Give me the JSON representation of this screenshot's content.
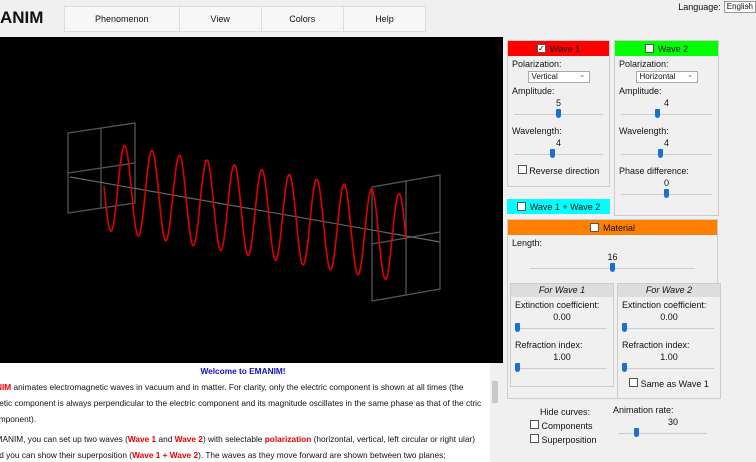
{
  "app": {
    "title": "ANIM"
  },
  "menu": [
    "Phenomenon",
    "View",
    "Colors",
    "Help"
  ],
  "language": {
    "label": "Language:",
    "value": "English"
  },
  "text": {
    "title": "Welcome to EMANIM!",
    "p1_strong": "ANIM",
    "p1": " animates electromagnetic waves in vacuum and in matter. For clarity, only the electric component is shown at all times (the gnetic component is always perpendicular to the electric component and its magnitude oscillates in the same phase as that of the ctric component).",
    "p2_a": "EMANIM, you can set up two waves (",
    "p2_w1": "Wave 1",
    "p2_and": " and ",
    "p2_w2": "Wave 2",
    "p2_b": ") with selectable ",
    "p2_pol": "polarization",
    "p2_c": " (horizontal, vertical, left circular or right ular) and you can show their superposition (",
    "p2_sum": "Wave 1 + Wave 2",
    "p2_d": "). The waves as they move forward are shown between two planes;"
  },
  "wave1": {
    "label": "Wave 1",
    "checked": true,
    "color": "#ff0000",
    "polarization_label": "Polarization:",
    "polarization": "Vertical",
    "amplitude_label": "Amplitude:",
    "amplitude": "5",
    "amplitude_frac": 0.5,
    "wavelength_label": "Wavelength:",
    "wavelength": "4",
    "wavelength_frac": 0.43,
    "reverse_label": "Reverse direction"
  },
  "wave2": {
    "label": "Wave 2",
    "checked": false,
    "color": "#00ff00",
    "polarization_label": "Polarization:",
    "polarization": "Horizontal",
    "amplitude_label": "Amplitude:",
    "amplitude": "4",
    "amplitude_frac": 0.4,
    "wavelength_label": "Wavelength:",
    "wavelength": "4",
    "wavelength_frac": 0.43,
    "phase_label": "Phase difference:",
    "phase": "0",
    "phase_frac": 0.5
  },
  "sum": {
    "label": "Wave 1 + Wave 2",
    "color": "#00ffff"
  },
  "material": {
    "label": "Material",
    "color": "#ff8000",
    "length_label": "Length:",
    "length": "16",
    "length_frac": 0.5,
    "w1": {
      "title": "For Wave 1",
      "ext_label": "Extinction coefficient:",
      "ext": "0.00",
      "ref_label": "Refraction index:",
      "ref": "1.00"
    },
    "w2": {
      "title": "For Wave 2",
      "ext_label": "Extinction coefficient:",
      "ext": "0.00",
      "ref_label": "Refraction index:",
      "ref": "1.00",
      "same_label": "Same as Wave 1"
    }
  },
  "hide": {
    "label": "Hide curves:",
    "components": "Components",
    "superposition": "Superposition"
  },
  "rate": {
    "label": "Animation rate:",
    "value": "30",
    "frac": 0.2
  }
}
